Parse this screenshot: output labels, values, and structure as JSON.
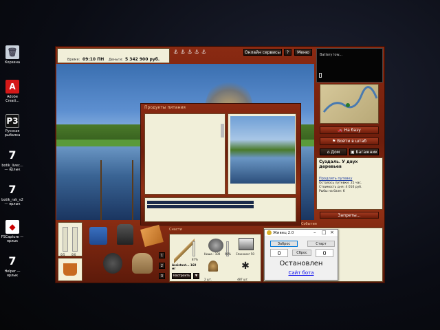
{
  "desktop": {
    "icons": [
      {
        "label": "Корзина",
        "icon": "recycle-bin-icon"
      },
      {
        "label": "Adobe Creati...",
        "icon": "adobe-cc-icon"
      },
      {
        "label": "Русская рыбалка",
        "icon": "rr3-icon"
      },
      {
        "label": "botik_livec... — ярлык",
        "icon": "botik-icon"
      },
      {
        "label": "botik_rak_v2 — ярлык",
        "icon": "botik-icon"
      },
      {
        "label": "FSCapture — ярлык",
        "icon": "fscapture-icon"
      },
      {
        "label": "Helper — ярлык",
        "icon": "helper-icon"
      }
    ]
  },
  "game": {
    "time_label": "Время:",
    "time_value": "09:10 ПН",
    "money_label": "Деньги:",
    "money_value": "5 342 900 руб.",
    "online_services": "Онлайн сервисы",
    "help": "?",
    "menu": "Меню",
    "battery": "Battery low...",
    "to_base": "На базу",
    "to_hq": "Войти в штаб",
    "home": "Дом",
    "luggage": "Багажник",
    "location_title": "Суздаль. У двух деревьев",
    "extend_trip": "Продлить путевку",
    "trip_left": "Осталось путевки: 21 час.",
    "trip_cost": "Стоимость дня: 4 010 руб.",
    "fish_in_net": "Рыбы на базе: 6",
    "bans": "Запреты...",
    "food_window_title": "Продукты питания",
    "tackle_title": "Снасти",
    "events_title": "События",
    "rod_name": "Assistant... 160 мг",
    "rod_percent": "87%",
    "reel_label": "Ниша - 100",
    "reel_percent": "90%",
    "line_label": "Спиннинг 50",
    "bait_count": "2 шт.",
    "bait_count2": "487 шт.",
    "setup_btn": "Настроить",
    "slot1": "1",
    "slot2": "2",
    "slot3": "3",
    "gauge1": "0/5",
    "gauge2": "0/0",
    "hunger_level": 0.0,
    "fatigue_level": 0.0
  },
  "bot_window": {
    "title": "Живец 2.0",
    "reset_btn": "Заброс",
    "start_btn": "Старт",
    "clear_btn": "Сброс",
    "count_left": "0",
    "count_right": "0",
    "status": "Остановлен",
    "site_link": "Сайт бота"
  }
}
